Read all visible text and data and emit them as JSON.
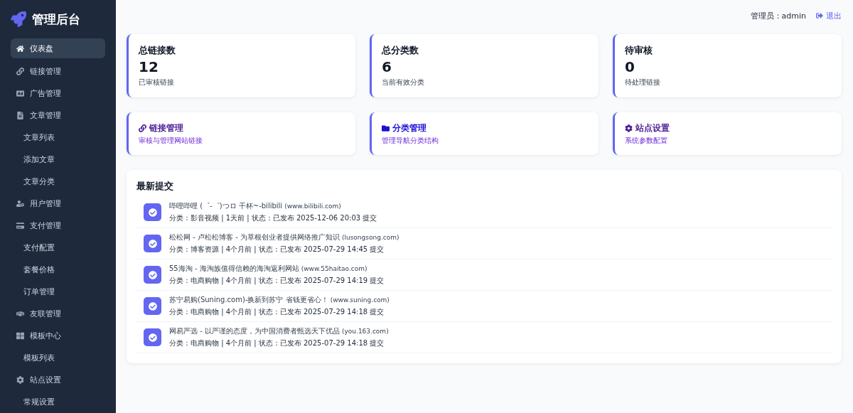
{
  "brand": {
    "title": "管理后台"
  },
  "sidebar": {
    "items": [
      {
        "label": "仪表盘",
        "kind": "section",
        "selected": true
      },
      {
        "label": "链接管理",
        "kind": "section",
        "selected": false
      },
      {
        "label": "广告管理",
        "kind": "section",
        "selected": false
      },
      {
        "label": "文章管理",
        "kind": "section",
        "selected": false
      },
      {
        "label": "文章列表",
        "kind": "sub",
        "selected": false
      },
      {
        "label": "添加文章",
        "kind": "sub",
        "selected": false
      },
      {
        "label": "文章分类",
        "kind": "sub",
        "selected": false
      },
      {
        "label": "用户管理",
        "kind": "section",
        "selected": false
      },
      {
        "label": "支付管理",
        "kind": "section",
        "selected": false
      },
      {
        "label": "支付配置",
        "kind": "sub",
        "selected": false
      },
      {
        "label": "套餐价格",
        "kind": "sub",
        "selected": false
      },
      {
        "label": "订单管理",
        "kind": "sub",
        "selected": false
      },
      {
        "label": "友联管理",
        "kind": "section",
        "selected": false
      },
      {
        "label": "模板中心",
        "kind": "section",
        "selected": false
      },
      {
        "label": "模板列表",
        "kind": "sub",
        "selected": false
      },
      {
        "label": "站点设置",
        "kind": "section",
        "selected": false
      },
      {
        "label": "常规设置",
        "kind": "sub",
        "selected": false
      }
    ]
  },
  "header": {
    "user": "管理员：admin",
    "logout": "退出"
  },
  "stats": [
    {
      "title": "总链接数",
      "value": "12",
      "note": "已审核链接"
    },
    {
      "title": "总分类数",
      "value": "6",
      "note": "当前有效分类"
    },
    {
      "title": "待审核",
      "value": "0",
      "note": "待处理链接"
    }
  ],
  "shortcuts": [
    {
      "title": "链接管理",
      "desc": "审核与管理网站链接",
      "color": "#4c1d95"
    },
    {
      "title": "分类管理",
      "desc": "管理导航分类结构",
      "color": "#1d0fd6"
    },
    {
      "title": "站点设置",
      "desc": "系统参数配置",
      "color": "#4c1d95"
    }
  ],
  "recent": {
    "title": "最新提交",
    "items": [
      {
        "name": "哔哩哔哩 (゜-゜)つロ 干杯~-bilibili",
        "domain": "(www.bilibili.com)",
        "meta": "分类：影音视频 | 1天前 | 状态：已发布 2025-12-06 20:03 提交"
      },
      {
        "name": "松松网 - 卢松松博客 - 为草根创业者提供网络推广知识",
        "domain": "(lusongsong.com)",
        "meta": "分类：博客资源 | 4个月前 | 状态：已发布 2025-07-29 14:45 提交"
      },
      {
        "name": "55海淘 - 海淘族值得信赖的海淘返利网站",
        "domain": "(www.55haitao.com)",
        "meta": "分类：电商购物 | 4个月前 | 状态：已发布 2025-07-29 14:19 提交"
      },
      {
        "name": "苏宁易购(Suning.com)-换新到苏宁 省钱更省心！",
        "domain": "(www.suning.com)",
        "meta": "分类：电商购物 | 4个月前 | 状态：已发布 2025-07-29 14:18 提交"
      },
      {
        "name": "网易严选 - 以严谨的态度，为中国消费者甄选天下优品",
        "domain": "(you.163.com)",
        "meta": "分类：电商购物 | 4个月前 | 状态：已发布 2025-07-29 14:18 提交"
      }
    ]
  }
}
